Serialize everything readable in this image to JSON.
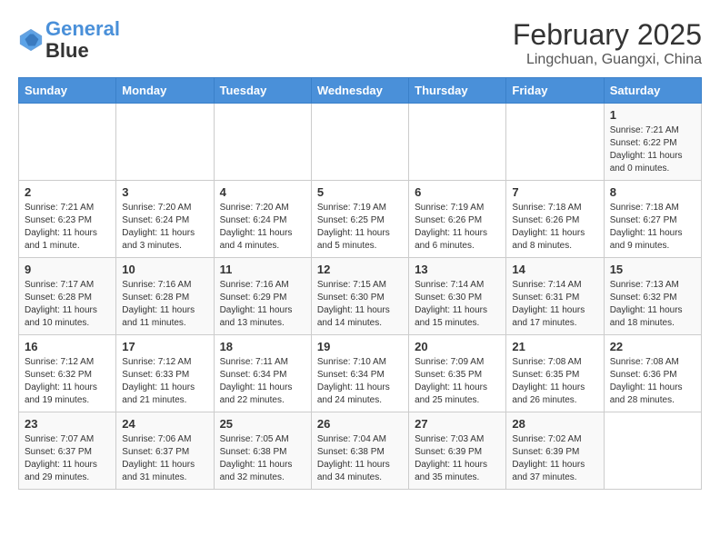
{
  "header": {
    "logo_line1": "General",
    "logo_line2": "Blue",
    "month_title": "February 2025",
    "location": "Lingchuan, Guangxi, China"
  },
  "days_of_week": [
    "Sunday",
    "Monday",
    "Tuesday",
    "Wednesday",
    "Thursday",
    "Friday",
    "Saturday"
  ],
  "weeks": [
    [
      {
        "day": "",
        "info": ""
      },
      {
        "day": "",
        "info": ""
      },
      {
        "day": "",
        "info": ""
      },
      {
        "day": "",
        "info": ""
      },
      {
        "day": "",
        "info": ""
      },
      {
        "day": "",
        "info": ""
      },
      {
        "day": "1",
        "info": "Sunrise: 7:21 AM\nSunset: 6:22 PM\nDaylight: 11 hours\nand 0 minutes."
      }
    ],
    [
      {
        "day": "2",
        "info": "Sunrise: 7:21 AM\nSunset: 6:23 PM\nDaylight: 11 hours\nand 1 minute."
      },
      {
        "day": "3",
        "info": "Sunrise: 7:20 AM\nSunset: 6:24 PM\nDaylight: 11 hours\nand 3 minutes."
      },
      {
        "day": "4",
        "info": "Sunrise: 7:20 AM\nSunset: 6:24 PM\nDaylight: 11 hours\nand 4 minutes."
      },
      {
        "day": "5",
        "info": "Sunrise: 7:19 AM\nSunset: 6:25 PM\nDaylight: 11 hours\nand 5 minutes."
      },
      {
        "day": "6",
        "info": "Sunrise: 7:19 AM\nSunset: 6:26 PM\nDaylight: 11 hours\nand 6 minutes."
      },
      {
        "day": "7",
        "info": "Sunrise: 7:18 AM\nSunset: 6:26 PM\nDaylight: 11 hours\nand 8 minutes."
      },
      {
        "day": "8",
        "info": "Sunrise: 7:18 AM\nSunset: 6:27 PM\nDaylight: 11 hours\nand 9 minutes."
      }
    ],
    [
      {
        "day": "9",
        "info": "Sunrise: 7:17 AM\nSunset: 6:28 PM\nDaylight: 11 hours\nand 10 minutes."
      },
      {
        "day": "10",
        "info": "Sunrise: 7:16 AM\nSunset: 6:28 PM\nDaylight: 11 hours\nand 11 minutes."
      },
      {
        "day": "11",
        "info": "Sunrise: 7:16 AM\nSunset: 6:29 PM\nDaylight: 11 hours\nand 13 minutes."
      },
      {
        "day": "12",
        "info": "Sunrise: 7:15 AM\nSunset: 6:30 PM\nDaylight: 11 hours\nand 14 minutes."
      },
      {
        "day": "13",
        "info": "Sunrise: 7:14 AM\nSunset: 6:30 PM\nDaylight: 11 hours\nand 15 minutes."
      },
      {
        "day": "14",
        "info": "Sunrise: 7:14 AM\nSunset: 6:31 PM\nDaylight: 11 hours\nand 17 minutes."
      },
      {
        "day": "15",
        "info": "Sunrise: 7:13 AM\nSunset: 6:32 PM\nDaylight: 11 hours\nand 18 minutes."
      }
    ],
    [
      {
        "day": "16",
        "info": "Sunrise: 7:12 AM\nSunset: 6:32 PM\nDaylight: 11 hours\nand 19 minutes."
      },
      {
        "day": "17",
        "info": "Sunrise: 7:12 AM\nSunset: 6:33 PM\nDaylight: 11 hours\nand 21 minutes."
      },
      {
        "day": "18",
        "info": "Sunrise: 7:11 AM\nSunset: 6:34 PM\nDaylight: 11 hours\nand 22 minutes."
      },
      {
        "day": "19",
        "info": "Sunrise: 7:10 AM\nSunset: 6:34 PM\nDaylight: 11 hours\nand 24 minutes."
      },
      {
        "day": "20",
        "info": "Sunrise: 7:09 AM\nSunset: 6:35 PM\nDaylight: 11 hours\nand 25 minutes."
      },
      {
        "day": "21",
        "info": "Sunrise: 7:08 AM\nSunset: 6:35 PM\nDaylight: 11 hours\nand 26 minutes."
      },
      {
        "day": "22",
        "info": "Sunrise: 7:08 AM\nSunset: 6:36 PM\nDaylight: 11 hours\nand 28 minutes."
      }
    ],
    [
      {
        "day": "23",
        "info": "Sunrise: 7:07 AM\nSunset: 6:37 PM\nDaylight: 11 hours\nand 29 minutes."
      },
      {
        "day": "24",
        "info": "Sunrise: 7:06 AM\nSunset: 6:37 PM\nDaylight: 11 hours\nand 31 minutes."
      },
      {
        "day": "25",
        "info": "Sunrise: 7:05 AM\nSunset: 6:38 PM\nDaylight: 11 hours\nand 32 minutes."
      },
      {
        "day": "26",
        "info": "Sunrise: 7:04 AM\nSunset: 6:38 PM\nDaylight: 11 hours\nand 34 minutes."
      },
      {
        "day": "27",
        "info": "Sunrise: 7:03 AM\nSunset: 6:39 PM\nDaylight: 11 hours\nand 35 minutes."
      },
      {
        "day": "28",
        "info": "Sunrise: 7:02 AM\nSunset: 6:39 PM\nDaylight: 11 hours\nand 37 minutes."
      },
      {
        "day": "",
        "info": ""
      }
    ]
  ]
}
